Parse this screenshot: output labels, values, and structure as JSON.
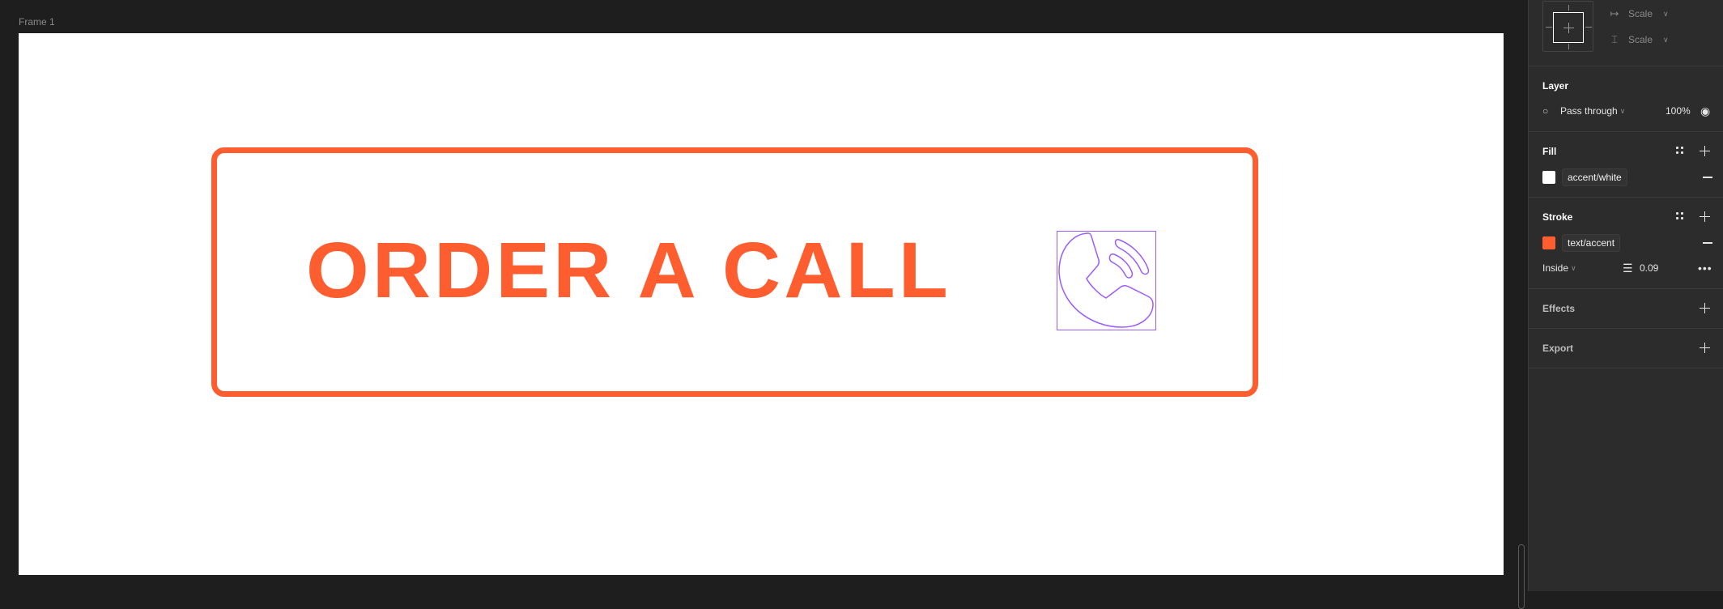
{
  "canvas": {
    "frame_label": "Frame 1",
    "button": {
      "text": "ORDER A CALL",
      "stroke_color": "#fe5d2f",
      "fill_color": "#ffffff",
      "icon": "phone-call-icon",
      "selection_color": "#9b5cff"
    }
  },
  "panel": {
    "constraints": {
      "horizontal": {
        "icon": "horizontal-constraint-icon",
        "value": "Scale"
      },
      "vertical": {
        "icon": "vertical-constraint-icon",
        "value": "Scale"
      }
    },
    "layer": {
      "title": "Layer",
      "blend_mode": "Pass through",
      "opacity": "100%",
      "visibility_icon": "eye-icon"
    },
    "fill": {
      "title": "Fill",
      "style_name": "accent/white",
      "swatch_color": "#ffffff"
    },
    "stroke": {
      "title": "Stroke",
      "style_name": "text/accent",
      "swatch_color": "#fe5d2f",
      "position": "Inside",
      "weight": "0.09"
    },
    "effects": {
      "title": "Effects"
    },
    "export": {
      "title": "Export"
    }
  }
}
